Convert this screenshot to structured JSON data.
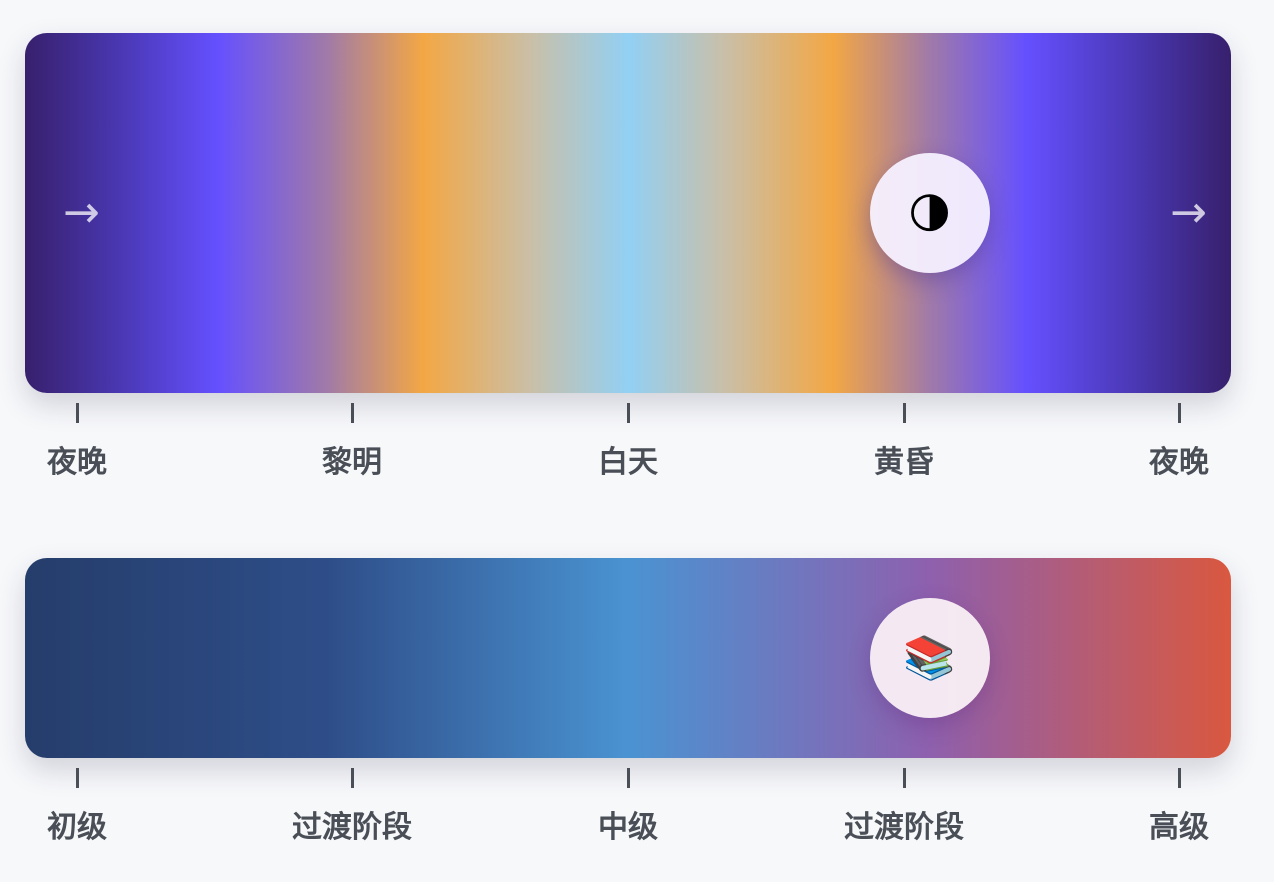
{
  "day_slider": {
    "arrow_left": "→",
    "arrow_right": "→",
    "thumb_icon": "🌗",
    "thumb_icon_name": "moon-icon",
    "value": 0.75,
    "ticks": [
      "夜晚",
      "黎明",
      "白天",
      "黄昏",
      "夜晚"
    ],
    "gradient_colors": [
      "#37206c",
      "#6550ff",
      "#f3a744",
      "#92d0f4",
      "#f3a744",
      "#6550ff",
      "#37206c"
    ]
  },
  "level_slider": {
    "thumb_icon": "📚",
    "thumb_icon_name": "books-icon",
    "value": 0.75,
    "ticks": [
      "初级",
      "过渡阶段",
      "中级",
      "过渡阶段",
      "高级"
    ],
    "gradient_colors": [
      "#253d6b",
      "#2e4d88",
      "#4a93d2",
      "#8e60ae",
      "#d9583f"
    ]
  }
}
